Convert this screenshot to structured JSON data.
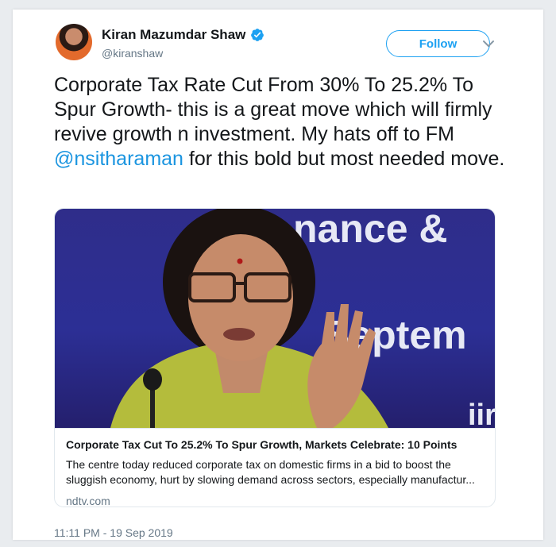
{
  "author": {
    "display_name": "Kiran Mazumdar Shaw",
    "handle": "@kiranshaw",
    "verified": true
  },
  "follow_label": "Follow",
  "tweet": {
    "text_before_mention": "Corporate Tax Rate Cut From 30% To 25.2% To Spur Growth- this is a great move which will firmly revive growth n investment. My hats off to FM ",
    "mention": "@nsitharaman",
    "text_after_mention": " for this bold but most needed move."
  },
  "card": {
    "image_backdrop_text_1": "nance &",
    "image_backdrop_text_2": "Septem",
    "image_backdrop_text_3": "iir",
    "title": "Corporate Tax Cut To 25.2% To Spur Growth, Markets Celebrate: 10 Points",
    "description": "The centre today reduced corporate tax on domestic firms in a bid to boost the sluggish economy, hurt by slowing demand across sectors, especially manufactur...",
    "domain": "ndtv.com"
  },
  "timestamp": "11:11 PM - 19 Sep 2019",
  "colors": {
    "accent": "#1da1f2",
    "mention": "#1b95e0",
    "text": "#14171a",
    "muted": "#657786"
  },
  "icons": {
    "verified": "verified-badge-icon",
    "more": "chevron-down-icon"
  }
}
